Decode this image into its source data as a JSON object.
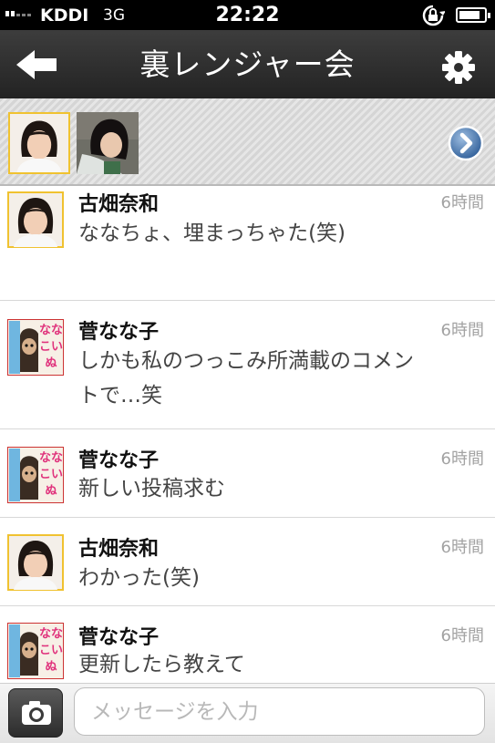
{
  "status_bar": {
    "carrier": "KDDI",
    "network": "3G",
    "time": "22:22"
  },
  "nav": {
    "title": "裏レンジャー会",
    "back_icon": "back-arrow-icon",
    "settings_icon": "gear-icon"
  },
  "members": {
    "next_icon": "chevron-right-icon"
  },
  "messages": [
    {
      "sender": "古畑奈和",
      "time": "6時間",
      "text": "ななちょ、埋まっちゃた(笑)",
      "avatar": "portrait-girl"
    },
    {
      "sender": "菅なな子",
      "time": "6時間",
      "text": "しかも私のつっこみ所満載のコメントで…笑",
      "avatar": "nanakoinu"
    },
    {
      "sender": "菅なな子",
      "time": "6時間",
      "text": "新しい投稿求む",
      "avatar": "nanakoinu"
    },
    {
      "sender": "古畑奈和",
      "time": "6時間",
      "text": "わかった(笑)",
      "avatar": "portrait-girl"
    },
    {
      "sender": "菅なな子",
      "time": "6時間",
      "text": "更新したら教えて",
      "avatar": "nanakoinu"
    }
  ],
  "composer": {
    "placeholder": "メッセージを入力",
    "value": "",
    "camera_icon": "camera-icon"
  },
  "colors": {
    "nav_bar": "#2e2e2e",
    "avatar_frame": "#f0c230",
    "time_text": "#a3a3a3",
    "next_button": "#2f5f9a"
  }
}
